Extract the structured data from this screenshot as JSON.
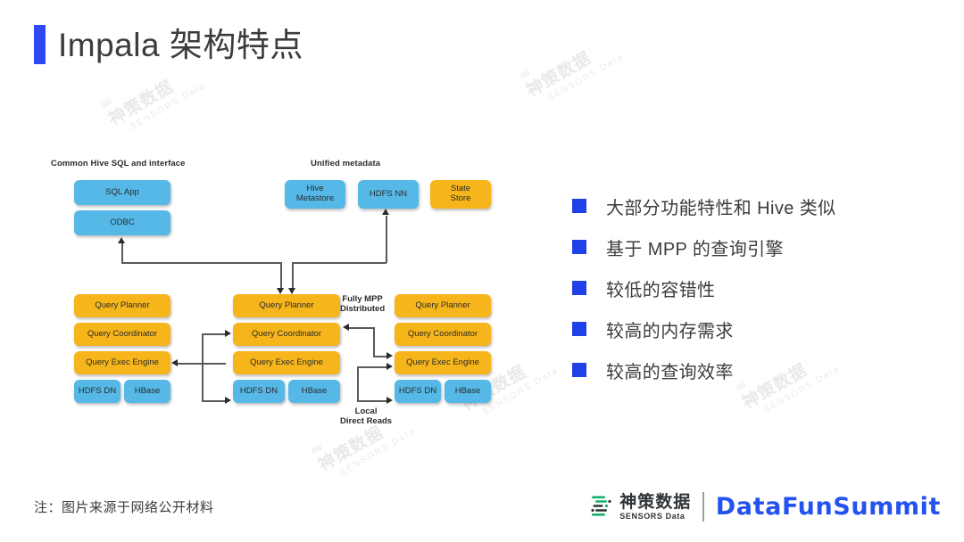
{
  "slide": {
    "title": "Impala 架构特点",
    "accent_color": "#3048f2",
    "footnote": "注：图片来源于网络公开材料",
    "watermark_cn": "神策数据",
    "watermark_en": "SENSORS Data"
  },
  "diagram": {
    "colors": {
      "blue": "#55b8e6",
      "orange": "#f6b51b",
      "line": "#58595b"
    },
    "group_labels": {
      "left": "Common Hive SQL and interface",
      "top": "Unified metadata"
    },
    "client_boxes": [
      {
        "label": "SQL App",
        "color": "blue"
      },
      {
        "label": "ODBC",
        "color": "blue"
      }
    ],
    "metadata_boxes": [
      {
        "label": "Hive\nMetastore",
        "line1": "Hive",
        "line2": "Metastore",
        "color": "blue"
      },
      {
        "label": "HDFS NN",
        "line1": "HDFS NN",
        "line2": "",
        "color": "blue"
      },
      {
        "label": "State\nStore",
        "line1": "State",
        "line2": "Store",
        "color": "orange"
      }
    ],
    "nodes": [
      {
        "name": "node-left",
        "rows": [
          {
            "label": "Query Planner",
            "color": "orange"
          },
          {
            "label": "Query Coordinator",
            "color": "orange"
          },
          {
            "label": "Query Exec Engine",
            "color": "orange"
          }
        ],
        "storage": [
          {
            "label": "HDFS DN",
            "color": "blue"
          },
          {
            "label": "HBase",
            "color": "blue"
          }
        ]
      },
      {
        "name": "node-middle",
        "rows": [
          {
            "label": "Query Planner",
            "color": "orange"
          },
          {
            "label": "Query Coordinator",
            "color": "orange"
          },
          {
            "label": "Query Exec Engine",
            "color": "orange"
          }
        ],
        "storage": [
          {
            "label": "HDFS DN",
            "color": "blue"
          },
          {
            "label": "HBase",
            "color": "blue"
          }
        ]
      },
      {
        "name": "node-right",
        "rows": [
          {
            "label": "Query Planner",
            "color": "orange"
          },
          {
            "label": "Query Coordinator",
            "color": "orange"
          },
          {
            "label": "Query Exec Engine",
            "color": "orange"
          }
        ],
        "storage": [
          {
            "label": "HDFS DN",
            "color": "blue"
          },
          {
            "label": "HBase",
            "color": "blue"
          }
        ]
      }
    ],
    "annotations": [
      {
        "name": "fully-mpp",
        "line1": "Fully MPP",
        "line2": "Distributed"
      },
      {
        "name": "local-direct-reads",
        "line1": "Local",
        "line2": "Direct Reads"
      }
    ]
  },
  "bullets": [
    {
      "text": "大部分功能特性和 Hive 类似"
    },
    {
      "text": "基于 MPP 的查询引擎"
    },
    {
      "text": "较低的容错性"
    },
    {
      "text": "较高的内存需求"
    },
    {
      "text": "较高的查询效率"
    }
  ],
  "footer": {
    "sensors_cn": "神策数据",
    "sensors_en": "SENSORS Data",
    "datafun": "DataFunSummit",
    "sensors_color": "#2f3437",
    "datafun_color": "#2452f0"
  }
}
